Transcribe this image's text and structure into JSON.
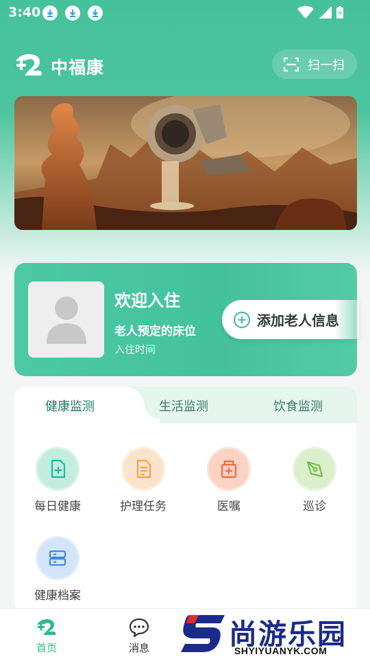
{
  "status_bar": {
    "time": "3:40",
    "download_icons": [
      "download-icon",
      "download-icon",
      "download-icon"
    ],
    "right_icons": [
      "wifi-icon",
      "cell-signal-icon",
      "battery-icon"
    ]
  },
  "header": {
    "title": "中福康",
    "scan_label": "扫一扫"
  },
  "welcome_card": {
    "title": "欢迎入住",
    "bed_label": "老人预定的床位",
    "checkin_label": "入住时间",
    "add_elder_label": "添加老人信息"
  },
  "tabs": [
    {
      "label": "健康监测",
      "active": true
    },
    {
      "label": "生活监测",
      "active": false
    },
    {
      "label": "饮食监测",
      "active": false
    }
  ],
  "features": [
    {
      "label": "每日健康",
      "icon": "health-document-icon",
      "color": "#1fb99a"
    },
    {
      "label": "护理任务",
      "icon": "task-list-icon",
      "color": "#f5a04b"
    },
    {
      "label": "医嘱",
      "icon": "medical-order-icon",
      "color": "#f06a3a"
    },
    {
      "label": "巡诊",
      "icon": "pen-nib-icon",
      "color": "#6fbf47"
    },
    {
      "label": "健康档案",
      "icon": "archive-icon",
      "color": "#3e8be0"
    }
  ],
  "bottom_nav": [
    {
      "label": "首页",
      "active": true,
      "icon": "home-logo-icon"
    },
    {
      "label": "消息",
      "active": false,
      "icon": "message-icon"
    }
  ],
  "watermark": {
    "text": "尚游乐园",
    "url": "SHYIYUANYK.COM"
  },
  "colors": {
    "primary": "#46c29a",
    "tab_bg": "#e5f6ef",
    "active_tab_text": "#1f7e62"
  }
}
